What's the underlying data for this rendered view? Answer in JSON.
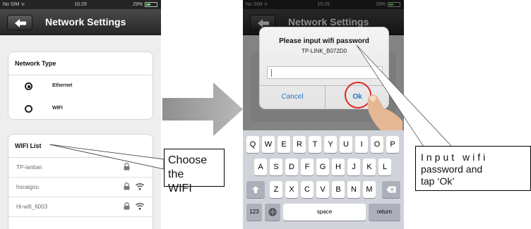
{
  "left_phone": {
    "status_bar": {
      "carrier": "No SIM ᯤ",
      "time": "10:29",
      "battery": "29%"
    },
    "nav": {
      "title": "Network Settings"
    },
    "network_type": {
      "header": "Network Type",
      "options": [
        {
          "label": "Ethernet",
          "selected": true
        },
        {
          "label": "WIFI",
          "selected": false
        }
      ]
    },
    "wifi_list": {
      "header": "WIFI List",
      "items": [
        {
          "name": "TP-lantian"
        },
        {
          "name": "hscaigou"
        },
        {
          "name": "Hi-wifi_6003"
        }
      ]
    }
  },
  "right_phone": {
    "status_bar": {
      "carrier": "No SIM ᯤ",
      "time": "10:29",
      "battery": "29%"
    },
    "nav": {
      "title": "Network Settings"
    },
    "dialog": {
      "title": "Please input wifi password",
      "ssid": "TP-LINK_B072D0",
      "input_value": "",
      "cancel_label": "Cancel",
      "ok_label": "Ok"
    },
    "keyboard": {
      "row1": [
        "Q",
        "W",
        "E",
        "R",
        "T",
        "Y",
        "U",
        "I",
        "O",
        "P"
      ],
      "row2": [
        "A",
        "S",
        "D",
        "F",
        "G",
        "H",
        "J",
        "K",
        "L"
      ],
      "row3": [
        "Z",
        "X",
        "C",
        "V",
        "B",
        "N",
        "M"
      ],
      "numbers_label": "123",
      "space_label": "space",
      "return_label": "return"
    }
  },
  "annotations": {
    "left_callout": {
      "line1": "Choose the",
      "line2": "WIFI"
    },
    "right_callout": {
      "line1": "Input wifi",
      "line2": "password and",
      "line3": "tap ‘Ok’"
    }
  },
  "colors": {
    "highlight_ring": "#e02424",
    "link_blue": "#2a72c9",
    "navbar": "#2d2d2d"
  }
}
